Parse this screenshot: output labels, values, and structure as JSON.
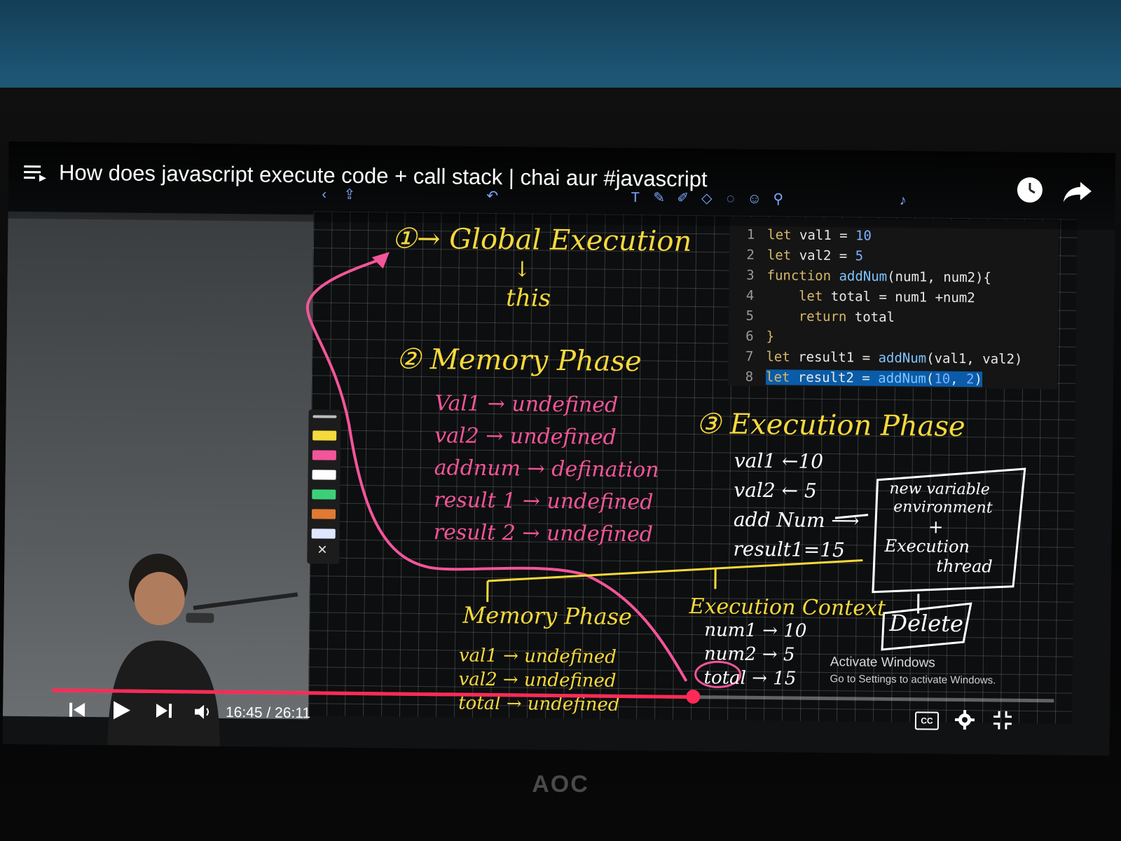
{
  "video": {
    "title": "How does javascript execute code + call stack | chai aur #javascript",
    "current_time": "16:45",
    "duration": "26:11",
    "time_display": "16:45 / 26:11",
    "progress_fraction": 0.64,
    "cc_label": "CC"
  },
  "code": {
    "lines": [
      {
        "n": "1",
        "tokens": [
          [
            "kw",
            "let "
          ],
          [
            "plain",
            "val1 = "
          ],
          [
            "num",
            "10"
          ]
        ]
      },
      {
        "n": "2",
        "tokens": [
          [
            "kw",
            "let "
          ],
          [
            "plain",
            "val2 = "
          ],
          [
            "num",
            "5"
          ]
        ]
      },
      {
        "n": "3",
        "tokens": [
          [
            "kw",
            "function "
          ],
          [
            "fn",
            "addNum"
          ],
          [
            "plain",
            "(num1, num2){"
          ]
        ]
      },
      {
        "n": "4",
        "tokens": [
          [
            "plain",
            "    "
          ],
          [
            "kw",
            "let "
          ],
          [
            "plain",
            "total = num1 +num2"
          ]
        ]
      },
      {
        "n": "5",
        "tokens": [
          [
            "plain",
            "    "
          ],
          [
            "kw",
            "return "
          ],
          [
            "plain",
            "total"
          ]
        ]
      },
      {
        "n": "6",
        "tokens": [
          [
            "kw",
            "}"
          ]
        ]
      },
      {
        "n": "7",
        "tokens": [
          [
            "kw",
            "let "
          ],
          [
            "plain",
            "result1 = "
          ],
          [
            "fn",
            "addNum"
          ],
          [
            "plain",
            "(val1, val2)"
          ]
        ]
      },
      {
        "n": "8",
        "tokens": [
          [
            "kw",
            "let "
          ],
          [
            "plain",
            "result2 = "
          ],
          [
            "fn",
            "addNum"
          ],
          [
            "plain",
            "("
          ],
          [
            "num",
            "10"
          ],
          [
            "plain",
            ", "
          ],
          [
            "num",
            "2"
          ],
          [
            "plain",
            ")"
          ]
        ],
        "highlight": true
      }
    ]
  },
  "board": {
    "global_heading": "①→ Global Execution",
    "global_arrow": "↓",
    "global_this": "this",
    "memory_heading": "② Memory Phase",
    "memory_items": [
      "Val1 → undefined",
      "val2 → undefined",
      "addnum → defination",
      "result 1 → undefined",
      "result 2 → undefined"
    ],
    "execution_heading": "③ Execution Phase",
    "execution_items": [
      "val1 ←10",
      "val2 ← 5",
      "add Num ⟶",
      "result1=15"
    ],
    "env_box_lines": [
      "new variable",
      "environment",
      "+",
      "Execution",
      "thread"
    ],
    "delete_label": "Delete",
    "sub_memory_heading": "Memory Phase",
    "sub_memory_items": [
      "val1 → undefined",
      "val2 → undefined",
      "total → undefined"
    ],
    "sub_exec_heading": "Execution Context",
    "sub_exec_items": [
      "num1 → 10",
      "num2 → 5",
      "total → 15"
    ]
  },
  "watermark": {
    "line1": "Activate Windows",
    "line2": "Go to Settings to activate Windows."
  },
  "monitor": {
    "brand": "AOC"
  },
  "colors": {
    "accent": "#ff2a55",
    "ink_yellow": "#f6d93c",
    "ink_pink": "#f2559a",
    "highlight": "#0a5ca8"
  },
  "icons": [
    "queue-icon",
    "clock-icon",
    "share-icon",
    "skip-previous-icon",
    "play-icon",
    "skip-next-icon",
    "volume-icon",
    "closed-captions-icon",
    "settings-icon",
    "fullscreen-exit-icon"
  ]
}
